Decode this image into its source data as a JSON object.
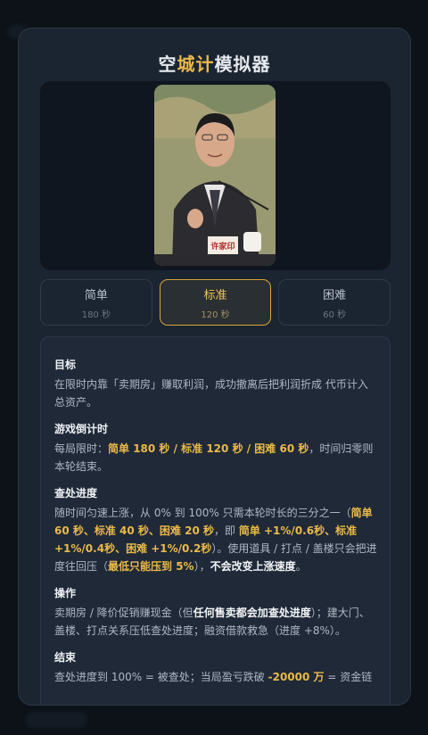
{
  "title": {
    "prefix": "空",
    "accent": "城计",
    "suffix": "模拟器"
  },
  "photo": {
    "nameplate": "许家印"
  },
  "difficulties": [
    {
      "name": "简单",
      "time": "180 秒",
      "active": false
    },
    {
      "name": "标准",
      "time": "120 秒",
      "active": true
    },
    {
      "name": "困难",
      "time": "60 秒",
      "active": false
    }
  ],
  "rules": {
    "goal": {
      "heading": "目标",
      "text": "在限时内靠「卖期房」赚取利润，成功撤离后把利润折成 代币计入总资产。"
    },
    "timer": {
      "heading": "游戏倒计时",
      "t1": "每局限时：",
      "h1": "简单 180 秒 / 标准 120 秒 / 困难 60 秒",
      "t2": "，时间归零则本轮结束。"
    },
    "progress": {
      "heading": "查处进度",
      "t1": "随时间匀速上涨，从 0% 到 100% 只需本轮时长的三分之一（",
      "h1": "简单 60 秒、标准 40 秒、困难 20 秒",
      "t2": "，即 ",
      "h2": "简单 +1%/0.6秒、标准 +1%/0.4秒、困难 +1%/0.2秒",
      "t3": "）。使用道具 / 打点 / 盖楼只会把进度往回压（",
      "h3": "最低只能压到 5%",
      "t4": "），",
      "h4": "不会改变上涨速度",
      "t5": "。"
    },
    "ops": {
      "heading": "操作",
      "t1": "卖期房 / 降价促销赚现金（但",
      "h1": "任何售卖都会加查处进度",
      "t2": "）；建大门、盖楼、打点关系压低查处进度；融资借款救急（进度 +8%）。"
    },
    "end": {
      "heading": "结束",
      "t1": "查处进度到 100% = 被查处；当局盈亏跌破 ",
      "h1": "-20000 万",
      "t2": " = 资金链"
    }
  }
}
